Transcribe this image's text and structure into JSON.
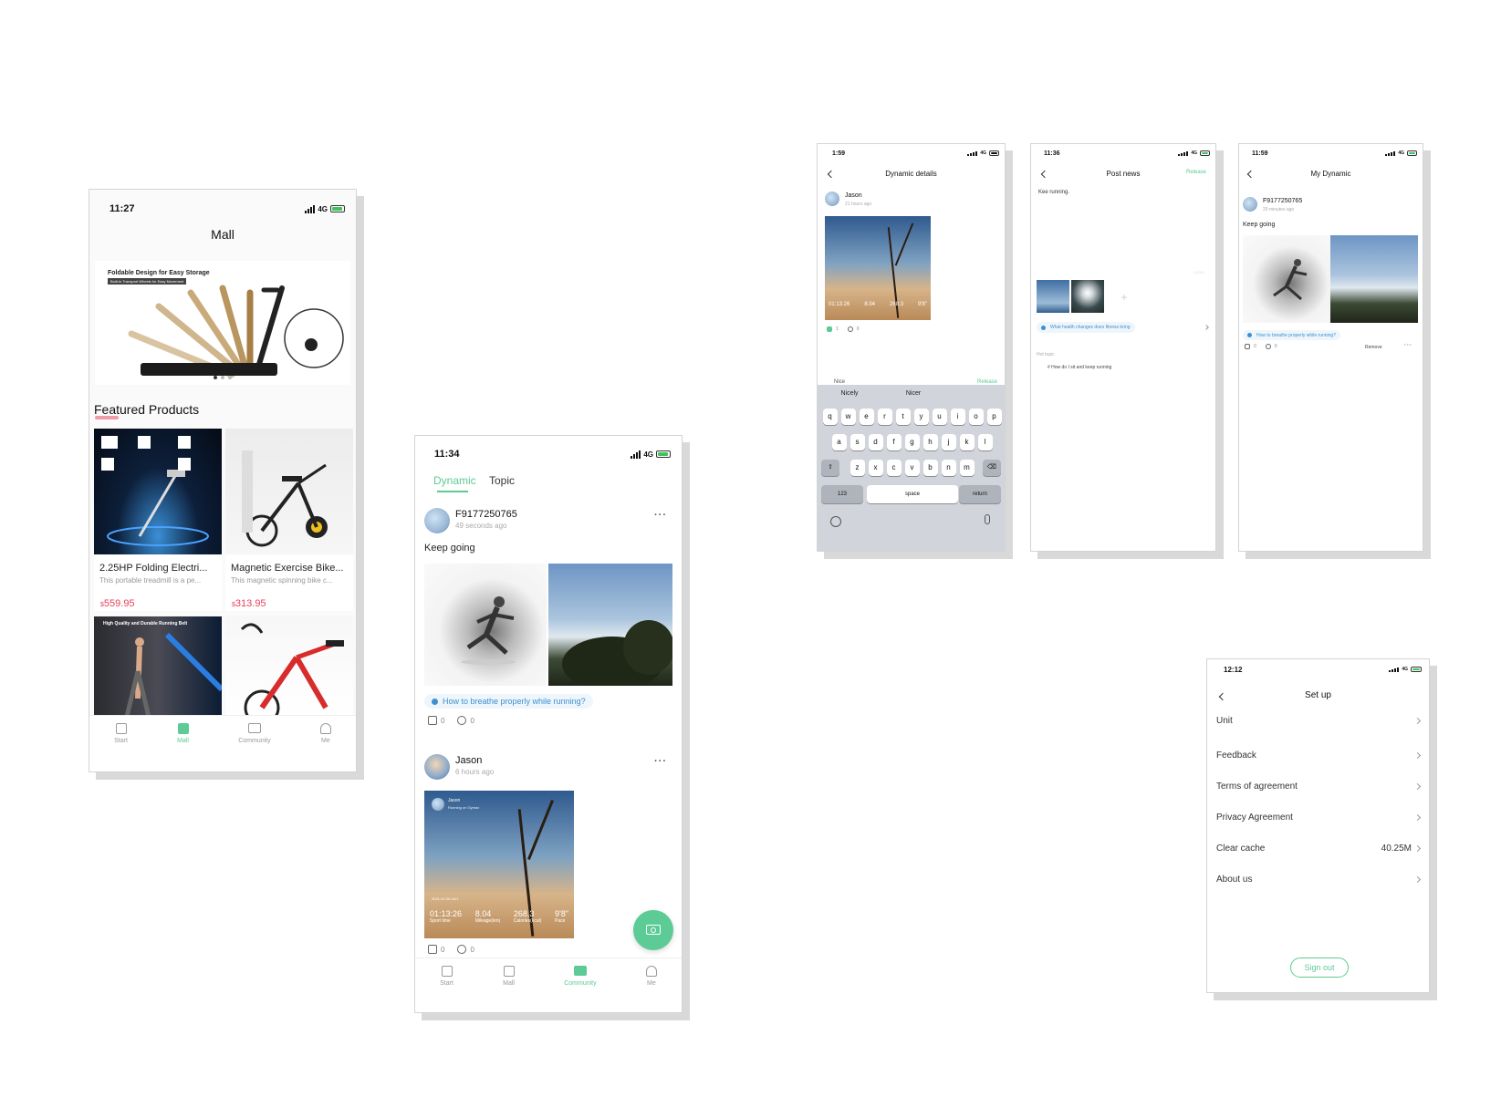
{
  "mall": {
    "time": "11:27",
    "network": "4G",
    "title": "Mall",
    "banner": {
      "headline": "Foldable Design for Easy Storage",
      "subline": "Built-in Transport Wheels for Easy Movement"
    },
    "section_title": "Featured Products",
    "products": [
      {
        "name": "2.25HP Folding Electri...",
        "desc": "This portable treadmill is a pe...",
        "currency": "$",
        "price": "559.95"
      },
      {
        "name": "Magnetic Exercise Bike...",
        "desc": "This magnetic spinning bike c...",
        "currency": "$",
        "price": "313.95"
      }
    ],
    "more_products_banner": "High Quality and Durable Running Belt",
    "tabs": [
      "Start",
      "Mall",
      "Community",
      "Me"
    ]
  },
  "community": {
    "time": "11:34",
    "network": "4G",
    "tabs": [
      "Dynamic",
      "Topic"
    ],
    "posts": [
      {
        "user": "F9177250765",
        "time": "49 seconds ago",
        "text": "Keep going",
        "topic": "How to breathe properly while running?",
        "likes": "0",
        "comments": "0"
      },
      {
        "user": "Jason",
        "time": "6 hours ago",
        "likes": "0",
        "comments": "0"
      }
    ],
    "run_card": {
      "user": "Jason",
      "sub": "Running on Gymax",
      "date": "2021-01-06 04/1",
      "stats": [
        {
          "value": "01:13:26",
          "label": "Sport time"
        },
        {
          "value": "8.04",
          "label": "Mileage(km)"
        },
        {
          "value": "268.3",
          "label": "Calories(kcal)"
        },
        {
          "value": "9'8\"",
          "label": "Pace"
        }
      ]
    },
    "bottom_tabs": [
      "Start",
      "Mall",
      "Community",
      "Me"
    ]
  },
  "details": {
    "time": "1:59",
    "network": "4G",
    "title": "Dynamic details",
    "user": "Jason",
    "ago": "21 hours ago",
    "run_stats": [
      "01:13:26",
      "8.04",
      "268.3",
      "9'8\""
    ],
    "likes": "1",
    "comments": "0",
    "input": "Nice",
    "release": "Release",
    "suggestions": [
      "Nicely",
      "Nicer"
    ],
    "rows": [
      [
        "q",
        "w",
        "e",
        "r",
        "t",
        "y",
        "u",
        "i",
        "o",
        "p"
      ],
      [
        "a",
        "s",
        "d",
        "f",
        "g",
        "h",
        "j",
        "k",
        "l"
      ],
      [
        "z",
        "x",
        "c",
        "v",
        "b",
        "n",
        "m"
      ]
    ],
    "key_123": "123",
    "key_space": "space",
    "key_return": "return"
  },
  "postnews": {
    "time": "11:36",
    "network": "4G",
    "title": "Post news",
    "release": "Release",
    "text": "Kee running.",
    "count": "12/500",
    "topic": "What health changes does fitness bring",
    "hot_label": "Hot topic",
    "hot_item": "# How do I sit and keep running"
  },
  "mydynamic": {
    "time": "11:59",
    "network": "4G",
    "title": "My Dynamic",
    "user": "F9177250765",
    "ago": "20 minutes ago",
    "text": "Keep going",
    "topic": "How to breathe properly while running?",
    "likes": "0",
    "comments": "0",
    "remove": "Remove"
  },
  "setup": {
    "time": "12:12",
    "network": "4G",
    "title": "Set up",
    "items": [
      {
        "label": "Unit",
        "value": ""
      },
      {
        "label": "Feedback",
        "value": ""
      },
      {
        "label": "Terms of agreement",
        "value": ""
      },
      {
        "label": "Privacy Agreement",
        "value": ""
      },
      {
        "label": "Clear cache",
        "value": "40.25M"
      },
      {
        "label": "About us",
        "value": ""
      }
    ],
    "signout": "Sign out"
  },
  "colors": {
    "accent": "#5ccb95",
    "price": "#e8425a",
    "topic": "#3d8fd0"
  }
}
